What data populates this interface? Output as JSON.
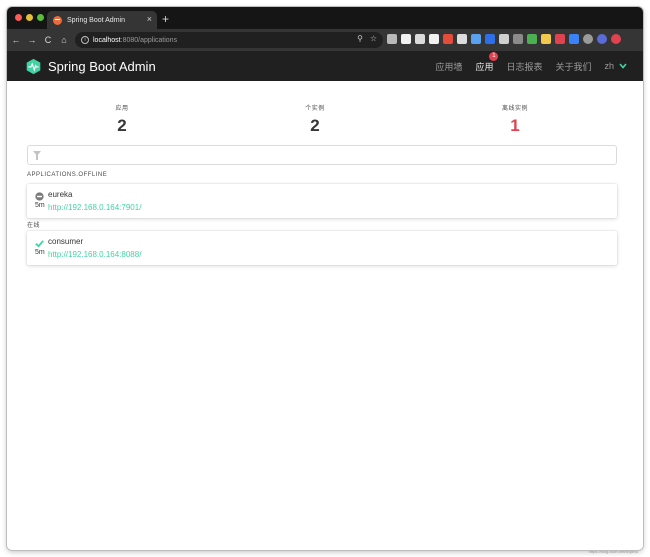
{
  "browser": {
    "tab_title": "Spring Boot Admin",
    "tab_close": "×",
    "new_tab": "+",
    "url_host": "localhost",
    "url_rest": ":8080/applications",
    "nav_back": "←",
    "nav_forward": "→",
    "nav_reload": "C",
    "nav_home": "⌂",
    "extension_colors": [
      "#b9b9b9",
      "#f1f1f1",
      "#dadada",
      "#f1f1f1",
      "#e34b3a",
      "#dcdcdc",
      "#5aa2f0",
      "#2d6fe8",
      "#cfcfcf",
      "#8b8b8b",
      "#4caf50",
      "#f2c94c",
      "#e0424f",
      "#3b82f6",
      "#9b9b9b",
      "#5b6bd8",
      "#e0424f"
    ]
  },
  "app": {
    "brand": "Spring Boot Admin",
    "accent": "#42d3a5",
    "danger": "#e0424f",
    "nav": [
      {
        "label": "应用墙"
      },
      {
        "label": "应用",
        "badge": "1"
      },
      {
        "label": "日志报表"
      },
      {
        "label": "关于我们"
      }
    ],
    "language": "zh"
  },
  "stats": [
    {
      "label": "应用",
      "value": "2"
    },
    {
      "label": "个实例",
      "value": "2"
    },
    {
      "label": "离线实例",
      "value": "1"
    }
  ],
  "filter": {
    "value": ""
  },
  "groups": [
    {
      "title": "APPLICATIONS.OFFLINE",
      "apps": [
        {
          "name": "eureka",
          "since": "5m",
          "url": "http://192.168.0.164:7901/",
          "status": "offline",
          "status_icon": "minus-circle-icon"
        }
      ]
    },
    {
      "title": "在线",
      "apps": [
        {
          "name": "consumer",
          "since": "5m",
          "url": "http://192.168.0.164:8088/",
          "status": "up",
          "status_icon": "check-icon"
        }
      ]
    }
  ],
  "watermark": "https://blog.csdn.net/tinjizhu"
}
